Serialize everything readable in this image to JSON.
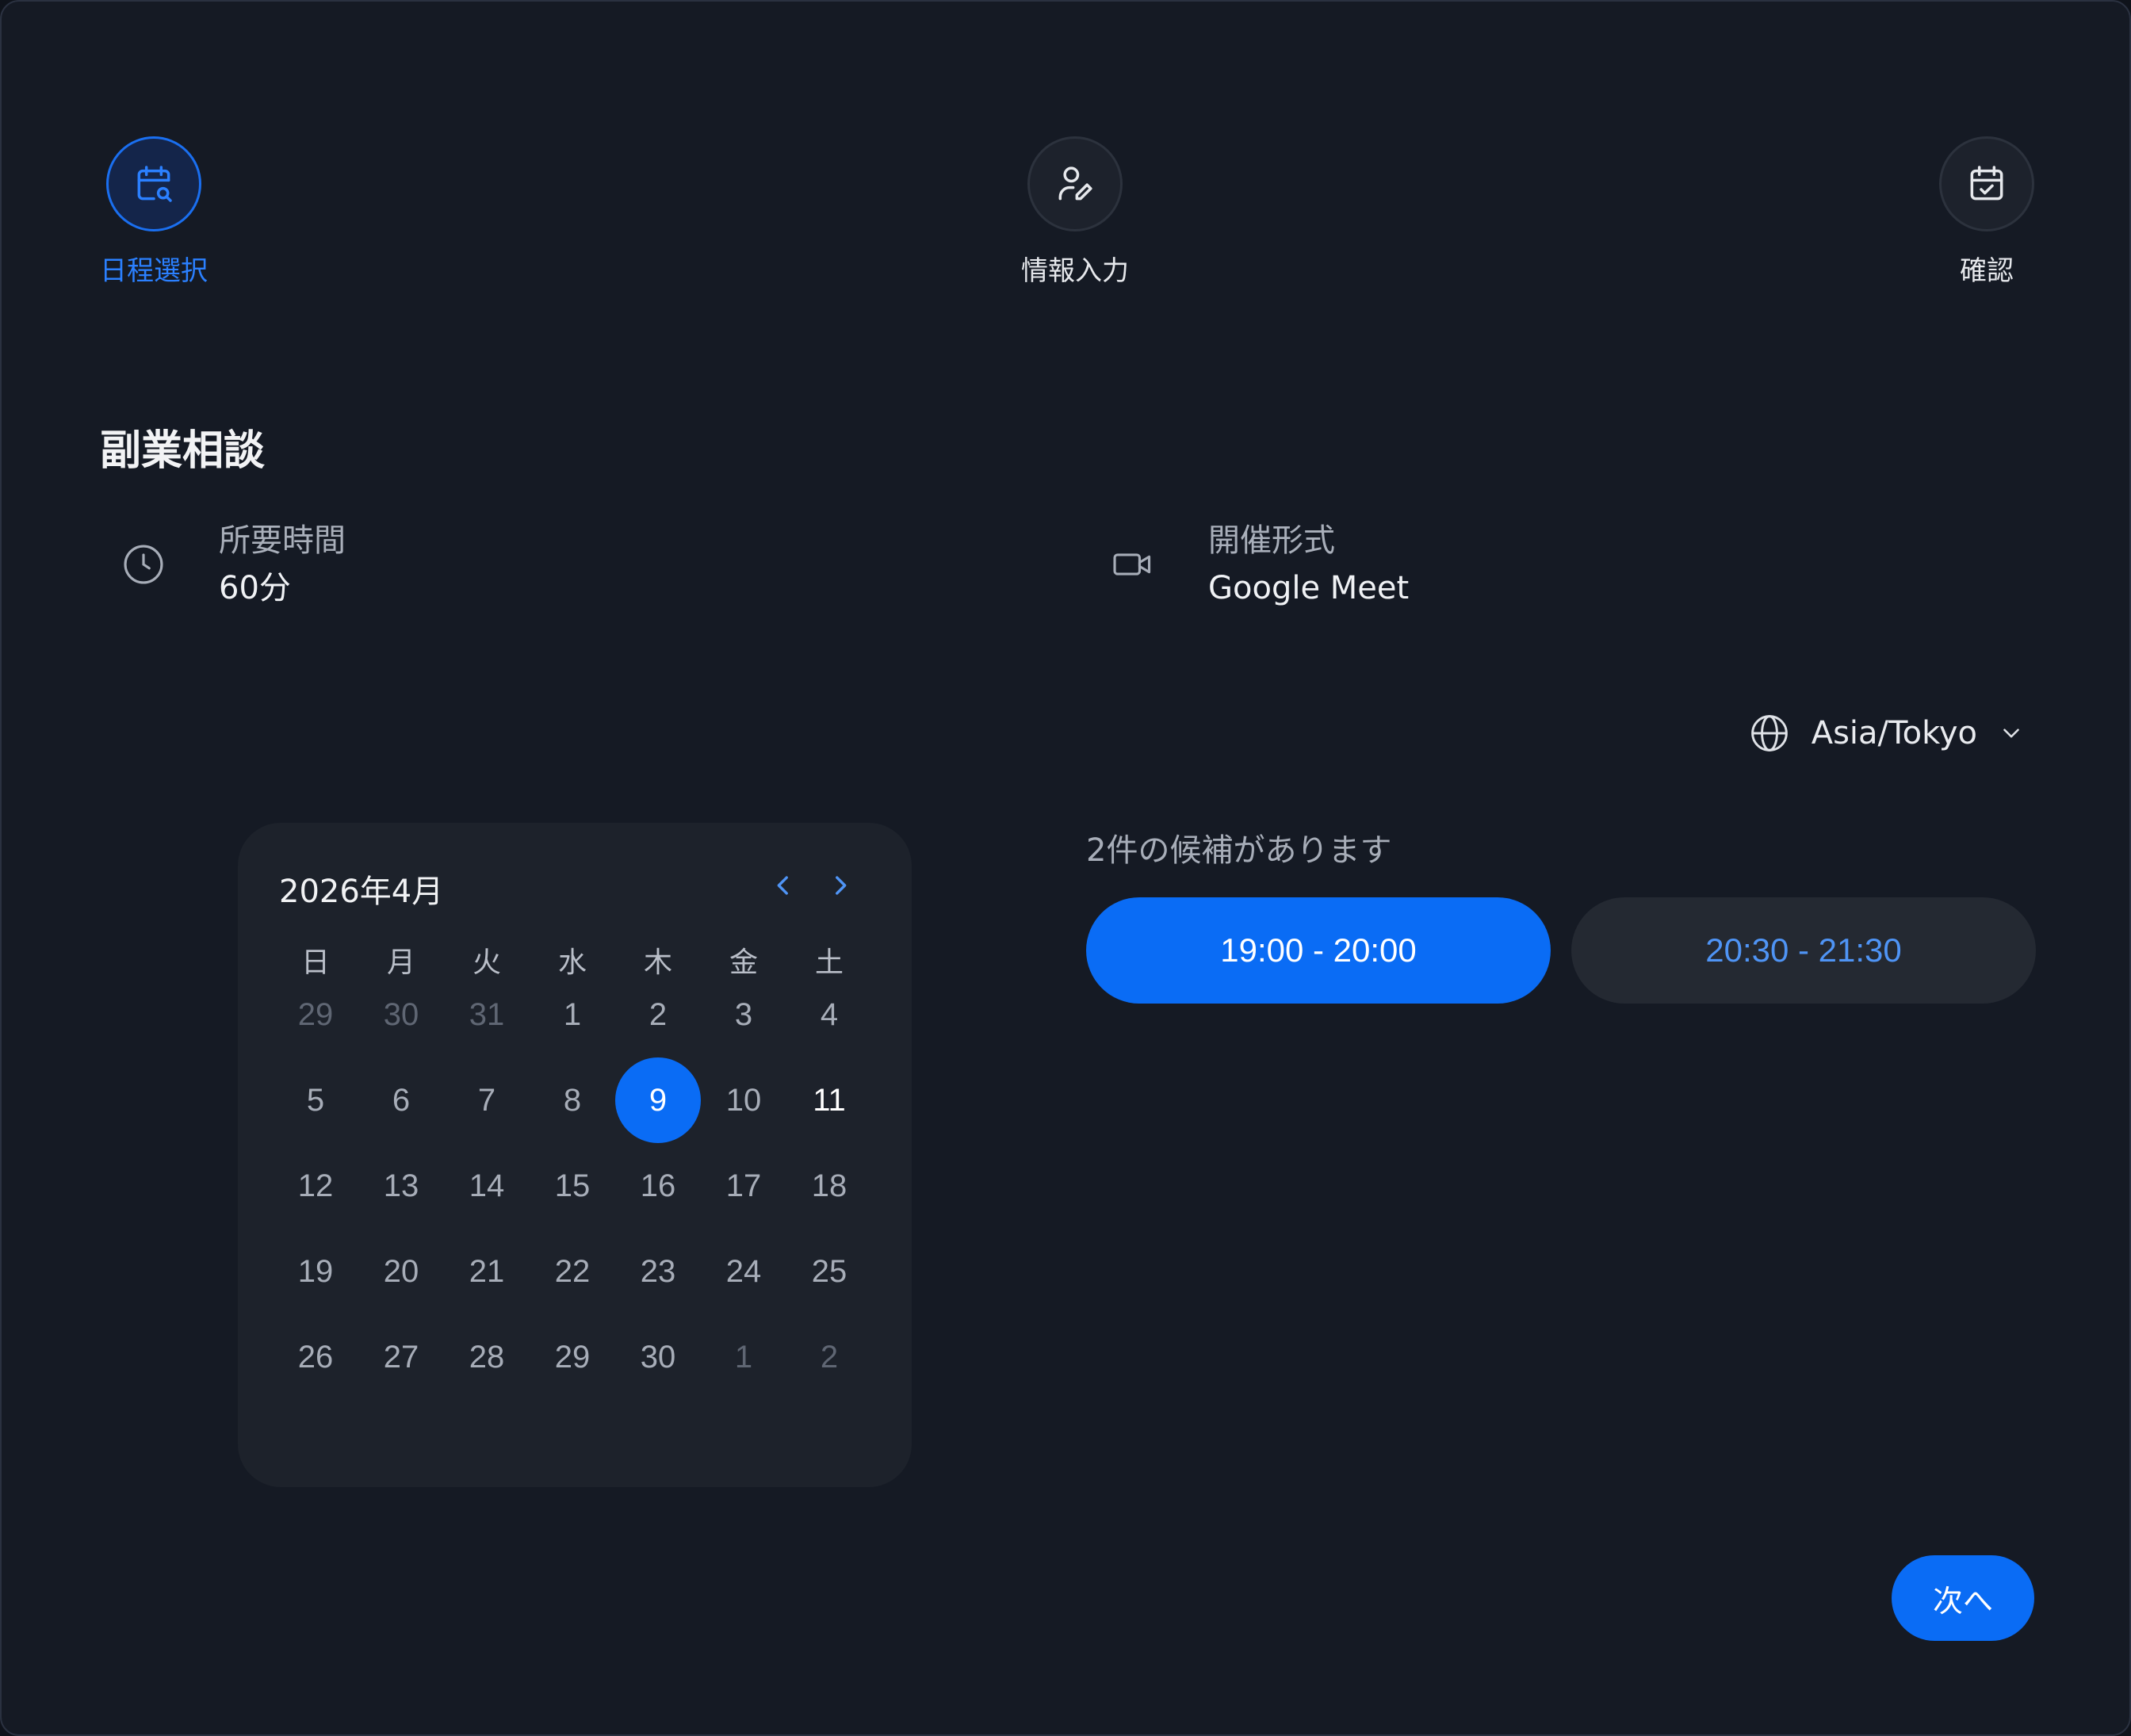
{
  "steps": [
    {
      "label": "日程選択",
      "icon": "calendar-search-icon",
      "active": true
    },
    {
      "label": "情報入力",
      "icon": "user-edit-icon",
      "active": false
    },
    {
      "label": "確認",
      "icon": "calendar-check-icon",
      "active": false
    }
  ],
  "event": {
    "title": "副業相談",
    "duration_label": "所要時間",
    "duration_value": "60分",
    "format_label": "開催形式",
    "format_value": "Google Meet"
  },
  "timezone": {
    "value": "Asia/Tokyo",
    "icon": "globe-icon"
  },
  "calendar": {
    "month_label": "2026年4月",
    "weekdays": [
      "日",
      "月",
      "火",
      "水",
      "木",
      "金",
      "土"
    ],
    "weeks": [
      [
        "29",
        "30",
        "31",
        "1",
        "2",
        "3",
        "4"
      ],
      [
        "5",
        "6",
        "7",
        "8",
        "9",
        "10",
        "11"
      ],
      [
        "12",
        "13",
        "14",
        "15",
        "16",
        "17",
        "18"
      ],
      [
        "19",
        "20",
        "21",
        "22",
        "23",
        "24",
        "25"
      ],
      [
        "26",
        "27",
        "28",
        "29",
        "30",
        "1",
        "2"
      ]
    ],
    "selected": "9"
  },
  "slots": {
    "count_text": "2件の候補があります",
    "items": [
      "19:00 - 20:00",
      "20:30 - 21:30"
    ]
  },
  "next_label": "次へ",
  "colors": {
    "accent": "#0a6cf5",
    "background": "#151a24",
    "panel": "#1d222b"
  }
}
